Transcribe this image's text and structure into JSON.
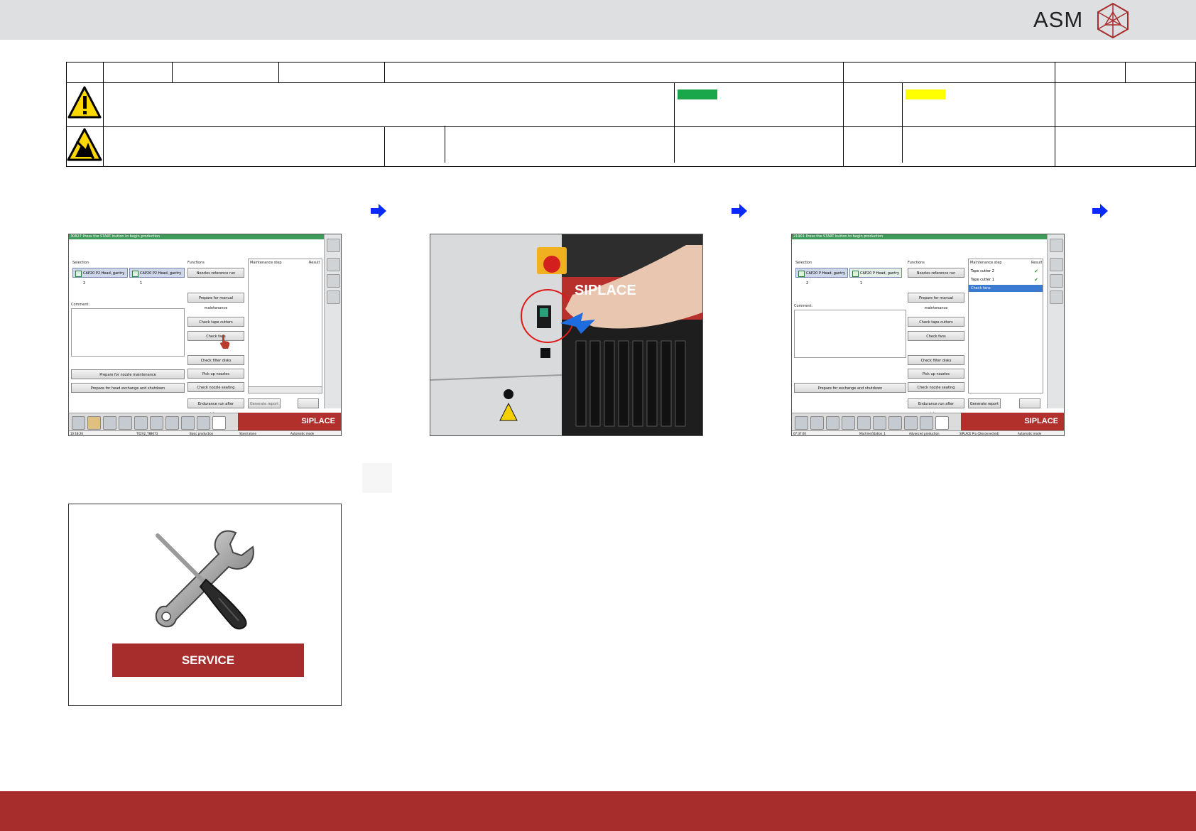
{
  "header": {
    "logo_text": "ASM"
  },
  "colors": {
    "brand_red": "#a62d2b",
    "status_green": "#1aa64a",
    "status_yellow": "#ffff00",
    "arrow_blue": "#0a2bff"
  },
  "icons": {
    "warning": "warning-triangle-icon",
    "esd": "esd-warning-icon",
    "arrow": "arrow-right-icon",
    "service": "wrench-screwdriver-icon"
  },
  "screen1": {
    "title": "30827 Press the START button to begin production",
    "selection_label": "Selection",
    "selected_heads": [
      "CAP20 P2 Head, gantry 2",
      "CAP20 P2 Head, gantry 1"
    ],
    "comment_label": "Comment:",
    "functions_label": "Functions",
    "maintenance_step_label": "Maintenance step",
    "result_label": "Result",
    "buttons": {
      "nozzles_reference_run": "Nozzles reference run",
      "prepare_manual": "Prepare for manual maintenance",
      "check_tape_cutters": "Check tape cutters",
      "check_fans": "Check fans",
      "check_filter_disks": "Check filter disks",
      "pick_up_nozzles": "Pick up nozzles",
      "check_nozzle_seating": "Check nozzle seating",
      "endurance_run": "Endurance run after maintenance",
      "generate_report": "Generate report",
      "prepare_nozzle": "Prepare for nozzle maintenance",
      "prepare_head": "Prepare for head exchange and shutdown"
    },
    "brand": "SIPLACE",
    "status": [
      "10:18:26",
      "TX2V2_T88073",
      "Basic production",
      "Stand alone",
      "Automatic mode"
    ]
  },
  "photo": {
    "brand": "SIPLACE"
  },
  "screen3": {
    "title": "21901 Press the START button to begin production",
    "selection_label": "Selection",
    "selected_heads": [
      "CAP20 P Head, gantry 2",
      "CAP20 P Head, gantry 1"
    ],
    "comment_label": "Comment:",
    "functions_label": "Functions",
    "maintenance_step_label": "Maintenance step",
    "result_label": "Result",
    "steps": [
      "Tape cutter 2",
      "Tape cutter 1",
      "Check fans"
    ],
    "buttons": {
      "nozzles_reference_run": "Nozzles reference run",
      "prepare_manual": "Prepare for manual maintenance",
      "check_tape_cutters": "Check tape cutters",
      "check_fans": "Check fans",
      "check_filter_disks": "Check filter disks",
      "pick_up_nozzles": "Pick up nozzles",
      "check_nozzle_seating": "Check nozzle seating",
      "endurance_run": "Endurance run after maintenance",
      "generate_report": "Generate report",
      "prepare_exchange": "Prepare for exchange and shutdown"
    },
    "brand": "SIPLACE",
    "status": [
      "07:37:00",
      "Machine\\Station_1",
      "Advanced production",
      "SIPLACE Pro (Disconnected)",
      "Automatic mode"
    ]
  },
  "service": {
    "label": "SERVICE"
  }
}
